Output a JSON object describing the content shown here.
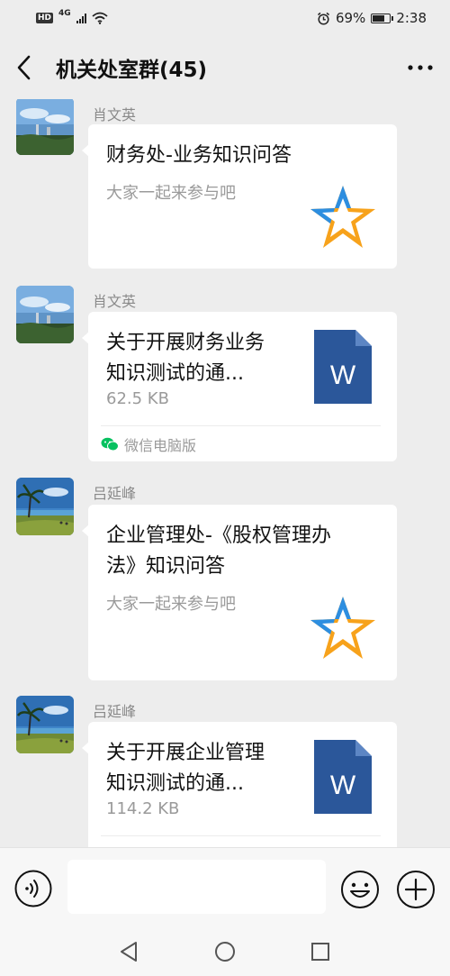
{
  "status_bar": {
    "hd_badge": "HD",
    "network": "4G",
    "battery_percent": "69%",
    "battery_level": 0.69,
    "time": "2:38"
  },
  "header": {
    "title": "机关处室群(45)"
  },
  "messages": [
    {
      "sender": "肖文英",
      "type": "quiz-card",
      "title_lines": [
        "财务处-业务知识问答"
      ],
      "description": "大家一起来参与吧",
      "icon": "star-icon"
    },
    {
      "sender": "肖文英",
      "type": "file",
      "title_lines": [
        "关于开展财务业务",
        "知识测试的通..."
      ],
      "file_size": "62.5 KB",
      "file_icon_letter": "W",
      "source": "微信电脑版"
    },
    {
      "sender": "吕延峰",
      "type": "quiz-card",
      "title_lines": [
        "企业管理处-《股权管理办",
        "法》知识问答"
      ],
      "description": "大家一起来参与吧",
      "icon": "star-icon"
    },
    {
      "sender": "吕延峰",
      "type": "file",
      "title_lines": [
        "关于开展企业管理",
        "知识测试的通..."
      ],
      "file_size": "114.2 KB",
      "file_icon_letter": "W"
    }
  ],
  "input_bar": {
    "placeholder": ""
  },
  "colors": {
    "background": "#ededed",
    "bubble": "#ffffff",
    "word_blue": "#2b579a",
    "wechat_green": "#07c160",
    "star_orange": "#f7a21b",
    "star_blue": "#2d8ee0"
  }
}
